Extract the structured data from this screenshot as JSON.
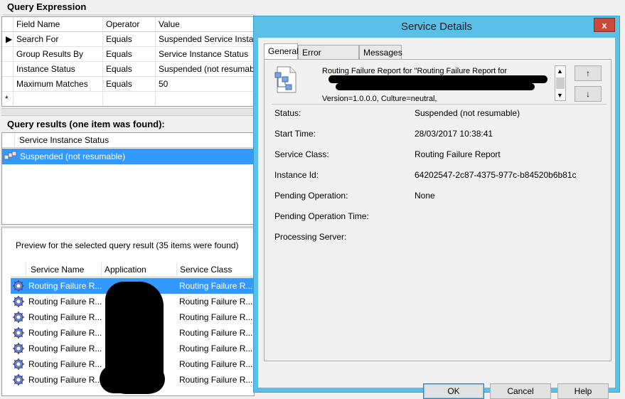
{
  "query_expression": {
    "title": "Query Expression",
    "columns": [
      "Field Name",
      "Operator",
      "Value"
    ],
    "rows": [
      {
        "field": "Search For",
        "operator": "Equals",
        "value": "Suspended Service Instance"
      },
      {
        "field": "Group Results By",
        "operator": "Equals",
        "value": "Service Instance Status"
      },
      {
        "field": "Instance Status",
        "operator": "Equals",
        "value": "Suspended (not resumable)"
      },
      {
        "field": "Maximum Matches",
        "operator": "Equals",
        "value": "50"
      }
    ],
    "new_row_marker": "*"
  },
  "query_results": {
    "title": "Query results (one item was found):",
    "column": "Service Instance Status",
    "row": "Suspended (not resumable)"
  },
  "preview": {
    "caption": "Preview for the selected query result (35 items were found)",
    "columns": [
      "Service Name",
      "Application",
      "Service Class"
    ],
    "rows": [
      {
        "name": "Routing Failure R...",
        "class": "Routing Failure R..."
      },
      {
        "name": "Routing Failure R...",
        "class": "Routing Failure R..."
      },
      {
        "name": "Routing Failure R...",
        "class": "Routing Failure R..."
      },
      {
        "name": "Routing Failure R...",
        "class": "Routing Failure R..."
      },
      {
        "name": "Routing Failure R...",
        "class": "Routing Failure R..."
      },
      {
        "name": "Routing Failure R...",
        "class": "Routing Failure R..."
      },
      {
        "name": "Routing Failure R...",
        "class": "Routing Failure R..."
      }
    ]
  },
  "dialog": {
    "title": "Service Details",
    "close_label": "x",
    "tabs": [
      "General",
      "Error Information",
      "Messages"
    ],
    "summary_line1": "Routing Failure Report for \"Routing Failure Report for",
    "summary_line4": "Version=1.0.0.0, Culture=neutral,",
    "scroll_up": "↑",
    "scroll_down": "↓",
    "fields": [
      {
        "label": "Status:",
        "value": "Suspended (not resumable)"
      },
      {
        "label": "Start Time:",
        "value": "28/03/2017 10:38:41"
      },
      {
        "label": "Service Class:",
        "value": "Routing Failure Report"
      },
      {
        "label": "Instance Id:",
        "value": "64202547-2c87-4375-977c-b84520b6b81c"
      },
      {
        "label": "Pending Operation:",
        "value": "None"
      },
      {
        "label": "Pending Operation Time:",
        "value": ""
      },
      {
        "label": "Processing Server:",
        "value": ""
      }
    ],
    "buttons": {
      "ok": "OK",
      "cancel": "Cancel",
      "help": "Help"
    }
  }
}
